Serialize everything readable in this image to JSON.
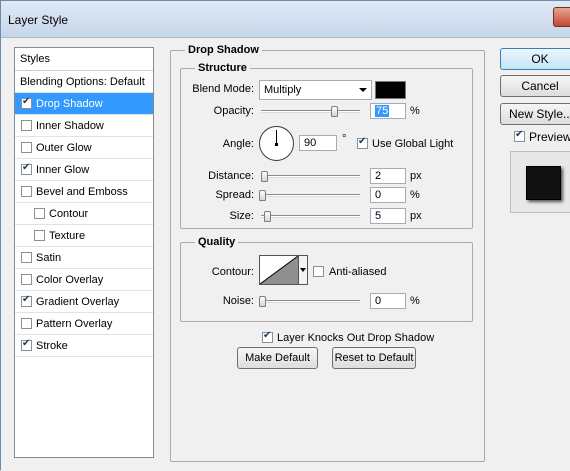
{
  "window": {
    "title": "Layer Style"
  },
  "styles_panel": {
    "header": "Styles",
    "items": [
      {
        "label": "Blending Options: Default",
        "checkbox": false,
        "checked": false,
        "selected": false
      },
      {
        "label": "Drop Shadow",
        "checkbox": true,
        "checked": true,
        "selected": true
      },
      {
        "label": "Inner Shadow",
        "checkbox": true,
        "checked": false,
        "selected": false
      },
      {
        "label": "Outer Glow",
        "checkbox": true,
        "checked": false,
        "selected": false
      },
      {
        "label": "Inner Glow",
        "checkbox": true,
        "checked": true,
        "selected": false
      },
      {
        "label": "Bevel and Emboss",
        "checkbox": true,
        "checked": false,
        "selected": false
      },
      {
        "label": "Contour",
        "checkbox": true,
        "checked": false,
        "selected": false,
        "sub": true
      },
      {
        "label": "Texture",
        "checkbox": true,
        "checked": false,
        "selected": false,
        "sub": true
      },
      {
        "label": "Satin",
        "checkbox": true,
        "checked": false,
        "selected": false
      },
      {
        "label": "Color Overlay",
        "checkbox": true,
        "checked": false,
        "selected": false
      },
      {
        "label": "Gradient Overlay",
        "checkbox": true,
        "checked": true,
        "selected": false
      },
      {
        "label": "Pattern Overlay",
        "checkbox": true,
        "checked": false,
        "selected": false
      },
      {
        "label": "Stroke",
        "checkbox": true,
        "checked": true,
        "selected": false
      }
    ]
  },
  "drop_shadow": {
    "section_title": "Drop Shadow",
    "structure": {
      "title": "Structure",
      "blend_mode_label": "Blend Mode:",
      "blend_mode_value": "Multiply",
      "shadow_color": "#000000",
      "opacity_label": "Opacity:",
      "opacity_value": "75",
      "opacity_unit": "%",
      "opacity_level": 0.75,
      "angle_label": "Angle:",
      "angle_value": "90",
      "angle_unit": "°",
      "use_global_light_label": "Use Global Light",
      "use_global_light_checked": true,
      "distance_label": "Distance:",
      "distance_value": "2",
      "distance_unit": "px",
      "spread_label": "Spread:",
      "spread_value": "0",
      "spread_unit": "%",
      "size_label": "Size:",
      "size_value": "5",
      "size_unit": "px"
    },
    "quality": {
      "title": "Quality",
      "contour_label": "Contour:",
      "anti_aliased_label": "Anti-aliased",
      "anti_aliased_checked": false,
      "noise_label": "Noise:",
      "noise_value": "0",
      "noise_unit": "%"
    },
    "knocks_out_label": "Layer Knocks Out Drop Shadow",
    "knocks_out_checked": true,
    "make_default_label": "Make Default",
    "reset_default_label": "Reset to Default"
  },
  "actions": {
    "ok_label": "OK",
    "cancel_label": "Cancel",
    "new_style_label": "New Style...",
    "preview_label": "Preview",
    "preview_checked": true
  }
}
